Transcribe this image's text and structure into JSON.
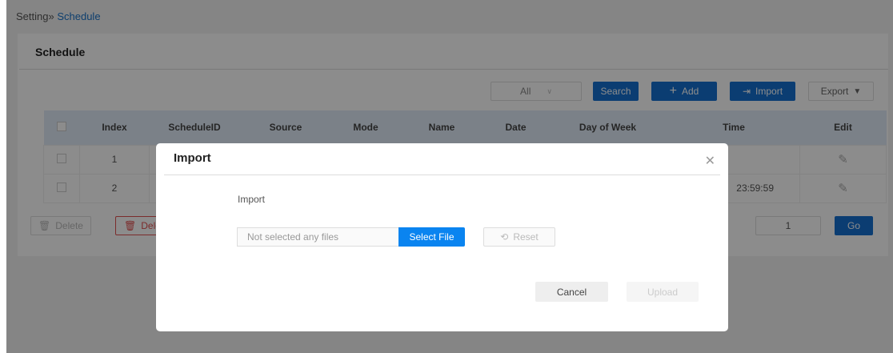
{
  "breadcrumb": {
    "parent": "Setting",
    "separator": "»",
    "current": "Schedule"
  },
  "panel": {
    "title": "Schedule"
  },
  "toolbar": {
    "filter_value": "All",
    "search": "Search",
    "add": "Add",
    "import": "Import",
    "export": "Export"
  },
  "table": {
    "headers": [
      "Index",
      "ScheduleID",
      "Source",
      "Mode",
      "Name",
      "Date",
      "Day of Week",
      "Time",
      "Edit"
    ],
    "rows": [
      {
        "index": "1",
        "time": ""
      },
      {
        "index": "2",
        "time": "23:59:59"
      }
    ]
  },
  "footer": {
    "delete": "Delete",
    "delete_all": "Delete All",
    "page": "1",
    "go": "Go"
  },
  "dialog": {
    "title": "Import",
    "label": "Import",
    "file_placeholder": "Not selected any files",
    "select_file": "Select File",
    "reset": "Reset",
    "cancel": "Cancel",
    "upload": "Upload"
  }
}
